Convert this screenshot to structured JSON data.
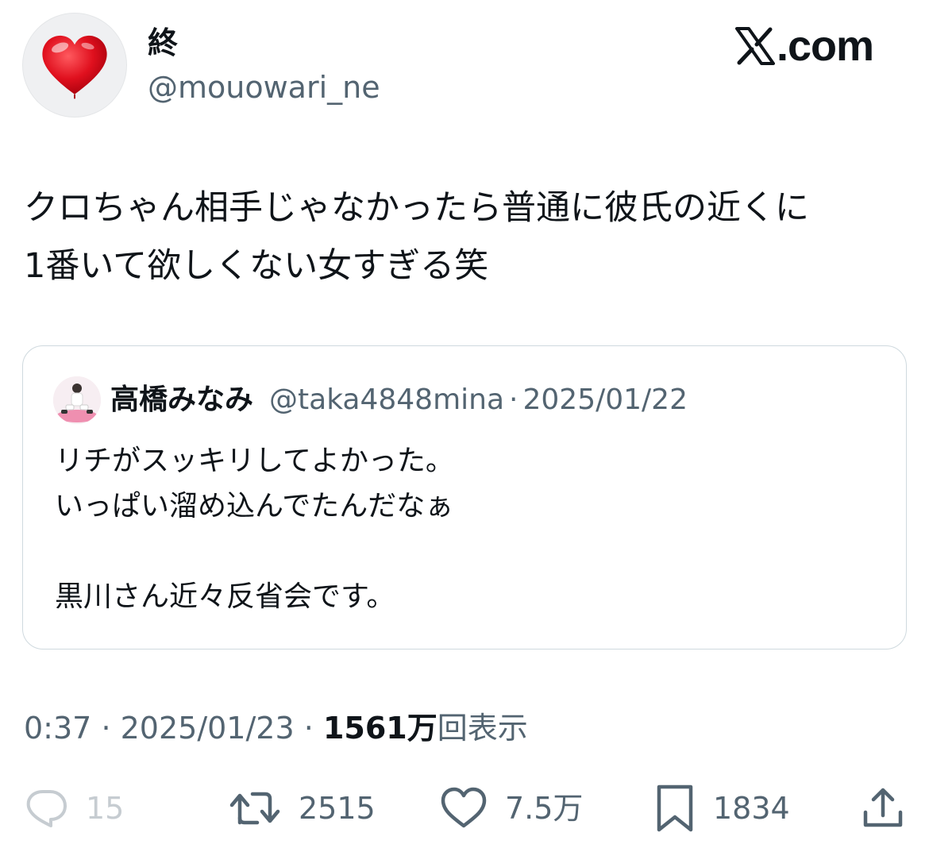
{
  "author": {
    "display_name": "終",
    "handle": "@mouowari_ne",
    "avatar_icon": "red-heart-icon"
  },
  "brand": {
    "text": "com",
    "full": "X.com"
  },
  "tweet": {
    "text": "クロちゃん相手じゃなかったら普通に彼氏の近くに\n1番いて欲しくない女すぎる笑"
  },
  "quote": {
    "display_name": "高橋みなみ",
    "handle": "@taka4848mina",
    "separator": "·",
    "date": "2025/01/22",
    "text": "リチがスッキリしてよかった。\nいっぱい溜め込んでたんだなぁ\n\n黒川さん近々反省会です。"
  },
  "meta": {
    "time": "0:37",
    "separator": "·",
    "date": "2025/01/23",
    "views_count": "1561万",
    "views_label": "回表示"
  },
  "actions": {
    "reply_count": "15",
    "retweet_count": "2515",
    "like_count": "7.5万",
    "bookmark_count": "1834"
  },
  "colors": {
    "text_primary": "#0f1419",
    "text_secondary": "#536471",
    "border": "#cfd9de",
    "heart_red": "#e0101e"
  }
}
